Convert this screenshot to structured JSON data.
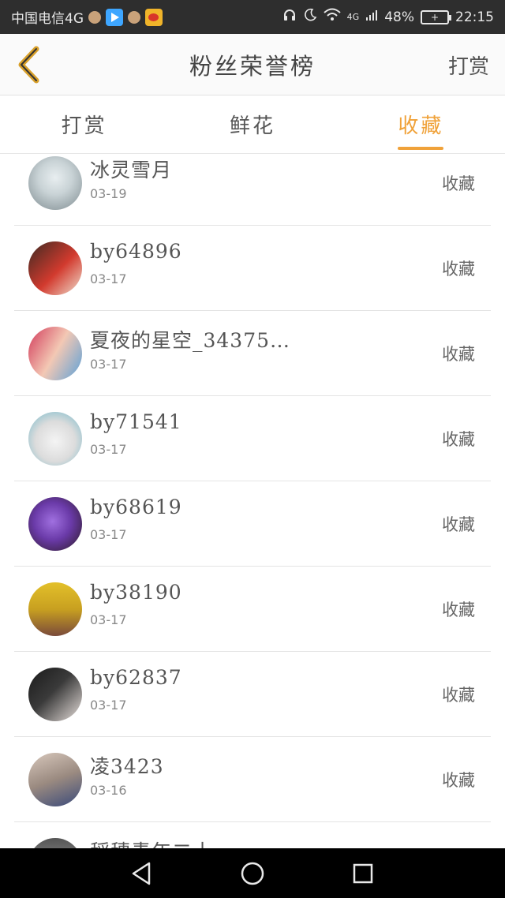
{
  "status_bar": {
    "carrier": "中国电信4G",
    "network": "4G",
    "battery": "48%",
    "time": "22:15"
  },
  "header": {
    "title": "粉丝荣誉榜",
    "action": "打赏"
  },
  "tabs": [
    {
      "label": "打赏",
      "active": false
    },
    {
      "label": "鲜花",
      "active": false
    },
    {
      "label": "收藏",
      "active": true
    }
  ],
  "accent_color": "#f0a23a",
  "list": [
    {
      "name": "冰灵雪月",
      "date": "03-19",
      "type": "收藏"
    },
    {
      "name": "by64896",
      "date": "03-17",
      "type": "收藏"
    },
    {
      "name": "夏夜的星空_34375…",
      "date": "03-17",
      "type": "收藏"
    },
    {
      "name": "by71541",
      "date": "03-17",
      "type": "收藏"
    },
    {
      "name": "by68619",
      "date": "03-17",
      "type": "收藏"
    },
    {
      "name": "by38190",
      "date": "03-17",
      "type": "收藏"
    },
    {
      "name": "by62837",
      "date": "03-17",
      "type": "收藏"
    },
    {
      "name": "凌3423",
      "date": "03-16",
      "type": "收藏"
    },
    {
      "name": "稻穗青年二十",
      "date": "",
      "type": ""
    }
  ]
}
